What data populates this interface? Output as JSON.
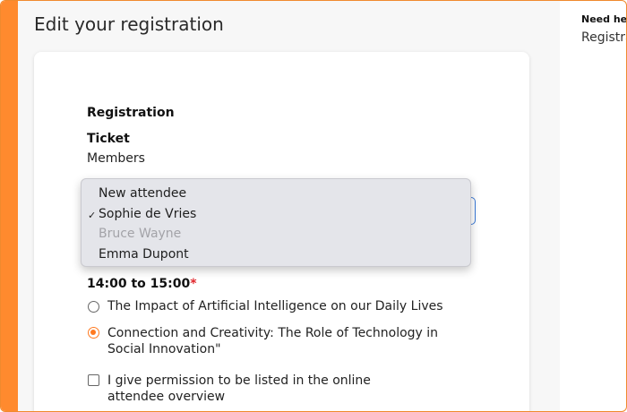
{
  "page": {
    "title": "Edit your registration"
  },
  "help": {
    "heading": "Need help?",
    "text": "Registration"
  },
  "form": {
    "section_title": "Registration",
    "ticket_label": "Ticket",
    "ticket_value": "Members",
    "attendee_options": [
      {
        "label": "New attendee",
        "selected": false,
        "disabled": false
      },
      {
        "label": "Sophie de Vries",
        "selected": true,
        "disabled": false
      },
      {
        "label": "Bruce Wayne",
        "selected": false,
        "disabled": true
      },
      {
        "label": "Emma Dupont",
        "selected": false,
        "disabled": false
      }
    ],
    "check_mark": "✓",
    "slot_label": "14:00 to 15:00",
    "required_mark": "*",
    "sessions": [
      {
        "label": "The Impact of Artificial Intelligence on our Daily Lives",
        "selected": false
      },
      {
        "label": "Connection and Creativity: The Role of Technology in Social Innovation\"",
        "selected": true
      }
    ],
    "permission_label": "I give permission to be listed in the online attendee overview",
    "permission_checked": false
  },
  "colors": {
    "accent": "#ff8a2e",
    "radio_selected": "#ff7a21",
    "focus": "#3a79d6",
    "required": "#e0262c"
  }
}
